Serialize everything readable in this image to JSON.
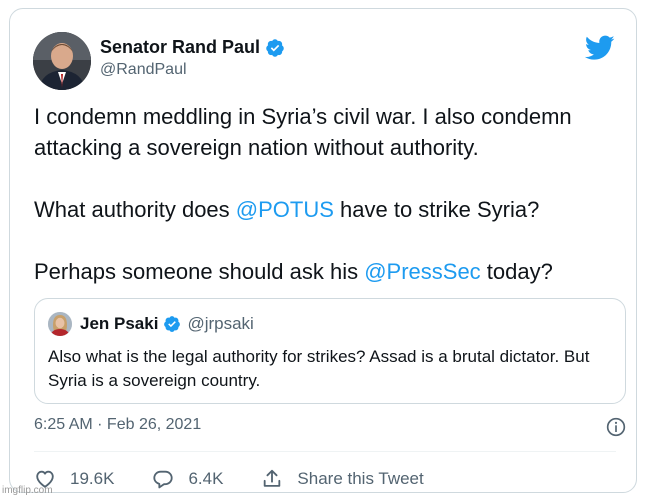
{
  "colors": {
    "accent": "#1d9bf0",
    "text": "#0f1419",
    "muted": "#536471",
    "border": "#cfd9de"
  },
  "tweet": {
    "author_name": "Senator Rand Paul",
    "author_handle": "@RandPaul",
    "verified_icon": "verified-badge-icon",
    "brand_icon": "twitter-bird-icon",
    "body": {
      "p1": "I condemn meddling in Syria’s civil war. I also condemn attacking a sovereign nation without authority.",
      "p2_pre": "What authority does ",
      "p2_mention": "@POTUS",
      "p2_post": " have to strike Syria?",
      "p3_pre": "Perhaps someone should ask his ",
      "p3_mention": "@PressSec",
      "p3_post": " today?"
    },
    "quoted": {
      "author_name": "Jen Psaki",
      "author_handle": "@jrpsaki",
      "text": "Also what is the legal authority for strikes? Assad is a brutal dictator. But Syria is a sovereign country."
    },
    "timestamp": "6:25 AM · Feb 26, 2021",
    "info_icon": "info-icon",
    "actions": {
      "likes": "19.6K",
      "replies": "6.4K",
      "share_label": "Share this Tweet"
    }
  },
  "watermark": "imgflip.com"
}
